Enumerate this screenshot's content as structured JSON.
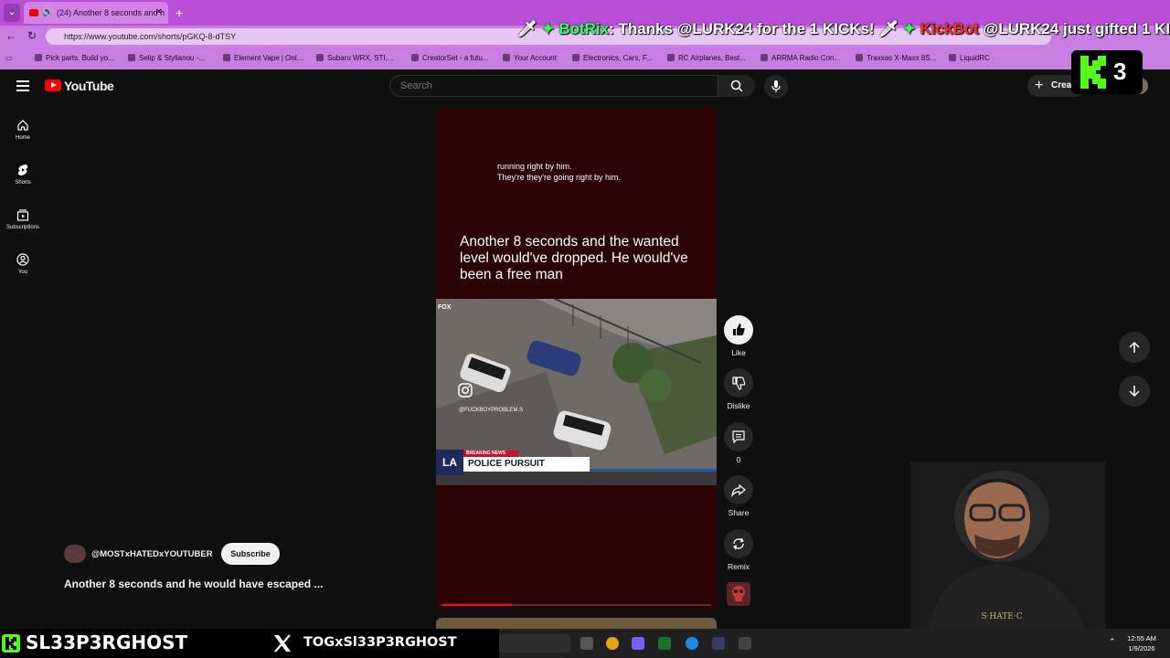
{
  "browser": {
    "tab_title": "(24) Another 8 seconds and h",
    "url": "https://www.youtube.com/shorts/pGKQ-8-dTSY",
    "bookmarks": [
      "Pick parts. Build yo...",
      "Selip & Stylianou -...",
      "Element Vape | Onl...",
      "Subaru WRX, STI,...",
      "CreatorSet - a futu...",
      "Your Account",
      "Electronics, Cars, F...",
      "RC Airplanes, Best...",
      "ARRMA Radio Con...",
      "Traxxas X-Maxx 8S...",
      "LiquidRC"
    ]
  },
  "ticker": {
    "bot1": "BotRix",
    "msg1": ": Thanks @LURK24 for the 1 KICKs!",
    "bot2": "KickBot",
    "msg2": " @LURK24 just gifted 1 KICKs!"
  },
  "youtube": {
    "logo": "YouTube",
    "search_placeholder": "Search",
    "create_label": "Creat",
    "sidebar": [
      {
        "label": "Home"
      },
      {
        "label": "Shorts"
      },
      {
        "label": "Subscriptions"
      },
      {
        "label": "You"
      }
    ]
  },
  "short": {
    "caption_line1": "running right by him.",
    "caption_line2": "They're they're going right by him.",
    "headline": "Another 8 seconds and the wanted level would've dropped. He would've been a free man",
    "watermark": "@FUCKBOYPROBLEM.S",
    "breaking_label": "BREAKING NEWS",
    "banner": "POLICE PURSUIT",
    "station": "LA",
    "progress": 0.26
  },
  "actions": {
    "like": "Like",
    "dislike": "Dislike",
    "comments": "0",
    "share": "Share",
    "remix": "Remix"
  },
  "channel": {
    "name": "@MOSTxHATEDxYOUTUBER",
    "subscribe": "Subscribe",
    "title": "Another 8 seconds and he would have escaped ..."
  },
  "overlay": {
    "kick_count": "3",
    "kick_handle": "SL33P3RGHOST",
    "x_handle": "TOGxSl33P3RGHOST"
  },
  "taskbar": {
    "time": "12:55 AM",
    "date": "1/9/2026"
  },
  "colors": {
    "kick_green": "#53fc18",
    "yt_red": "#ff0000",
    "browser_purple": "#b94fd6"
  }
}
